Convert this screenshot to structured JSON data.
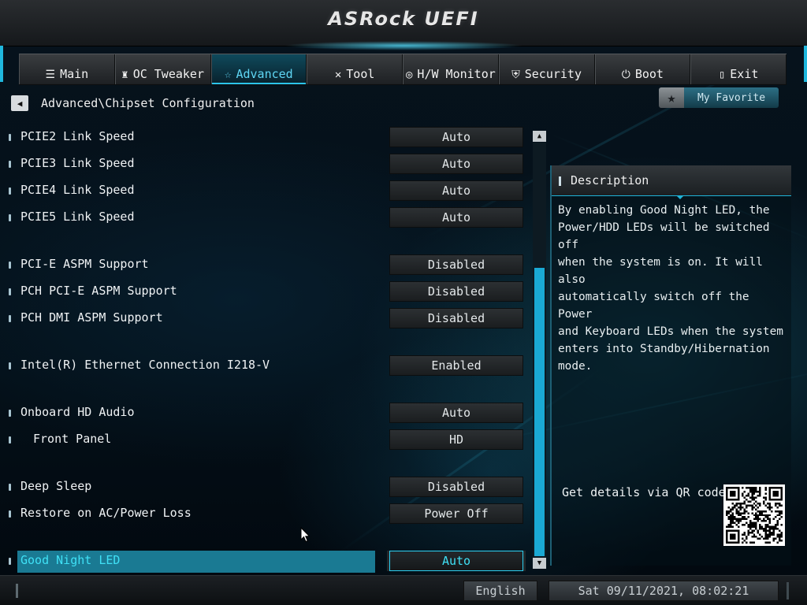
{
  "header": {
    "logo_text": "ASRock UEFI"
  },
  "tabs": [
    {
      "label": "Main",
      "icon": "list-icon",
      "glyph": "☰",
      "active": false
    },
    {
      "label": "OC Tweaker",
      "icon": "rocket-icon",
      "glyph": "♜",
      "active": false
    },
    {
      "label": "Advanced",
      "icon": "star-icon",
      "glyph": "☆",
      "active": true
    },
    {
      "label": "Tool",
      "icon": "wrench-icon",
      "glyph": "✕",
      "active": false
    },
    {
      "label": "H/W Monitor",
      "icon": "monitor-icon",
      "glyph": "◎",
      "active": false
    },
    {
      "label": "Security",
      "icon": "shield-icon",
      "glyph": "⛨",
      "active": false
    },
    {
      "label": "Boot",
      "icon": "power-icon",
      "glyph": "⏻",
      "active": false
    },
    {
      "label": "Exit",
      "icon": "exit-door-icon",
      "glyph": "▯",
      "active": false
    }
  ],
  "breadcrumb": {
    "path": "Advanced\\Chipset Configuration"
  },
  "favorite": {
    "label": "My Favorite"
  },
  "settings": [
    {
      "label": "PCIE2 Link Speed",
      "value": "Auto"
    },
    {
      "label": "PCIE3 Link Speed",
      "value": "Auto"
    },
    {
      "label": "PCIE4 Link Speed",
      "value": "Auto"
    },
    {
      "label": "PCIE5 Link Speed",
      "value": "Auto"
    },
    {
      "label": "PCI-E ASPM Support",
      "value": "Disabled"
    },
    {
      "label": "PCH PCI-E ASPM Support",
      "value": "Disabled"
    },
    {
      "label": "PCH DMI ASPM Support",
      "value": "Disabled"
    },
    {
      "label": "Intel(R) Ethernet Connection I218-V",
      "value": "Enabled"
    },
    {
      "label": "Onboard HD Audio",
      "value": "Auto"
    },
    {
      "label": "Front Panel",
      "value": "HD"
    },
    {
      "label": "Deep Sleep",
      "value": "Disabled"
    },
    {
      "label": "Restore on AC/Power Loss",
      "value": "Power Off"
    },
    {
      "label": "Good Night LED",
      "value": "Auto"
    }
  ],
  "description": {
    "title": "Description",
    "text": "By enabling Good Night LED, the\nPower/HDD LEDs will be switched off\nwhen the system is on. It will also\nautomatically switch off the Power\nand Keyboard LEDs when the system\nenters into Standby/Hibernation\nmode.",
    "qr_label": "Get details via QR code"
  },
  "footer": {
    "language": "English",
    "datetime": "Sat 09/11/2021, 08:02:21"
  },
  "colors": {
    "accent": "#1fb8de",
    "selection": "#1a7a93",
    "selected_text": "#3fe0f5"
  }
}
